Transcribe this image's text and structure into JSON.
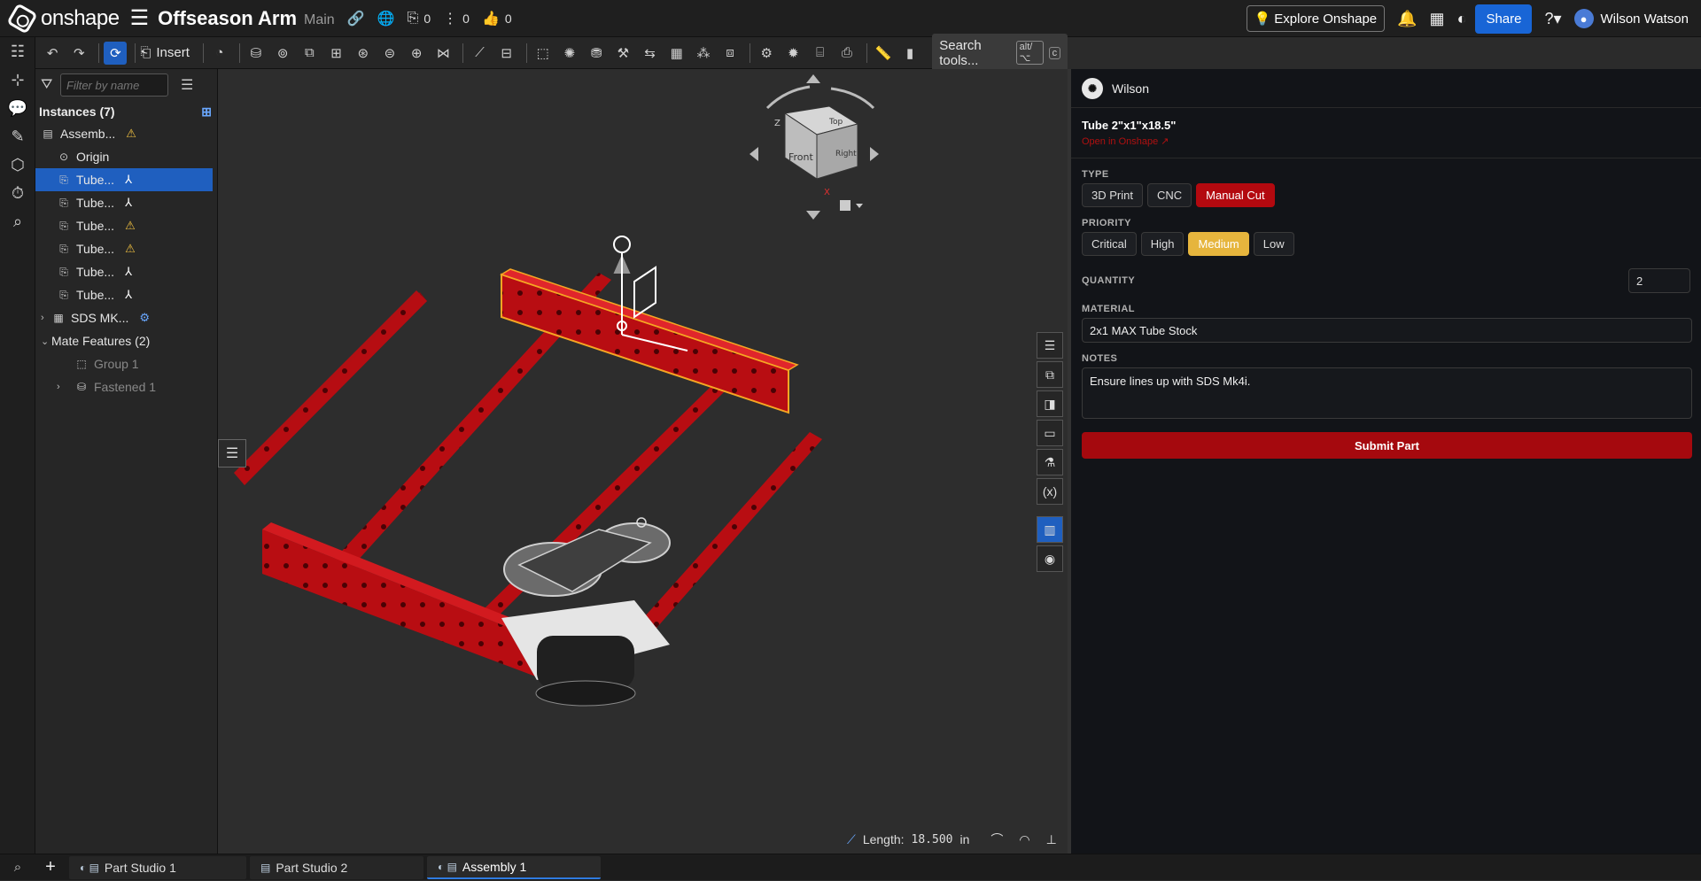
{
  "app": {
    "brand": "onshape",
    "doc_title": "Offseason Arm",
    "branch": "Main",
    "counts": {
      "versions": "0",
      "branches": "0",
      "likes": "0"
    },
    "explore_label": "Explore Onshape",
    "share_label": "Share",
    "user_name": "Wilson Watson"
  },
  "toolbar": {
    "insert_label": "Insert",
    "search_label": "Search tools...",
    "search_kbd1": "alt/⌥",
    "search_kbd2": "c"
  },
  "panel": {
    "filter_placeholder": "Filter by name",
    "instances_header": "Instances (7)",
    "items": [
      {
        "label": "Assemb...",
        "badge": "⚠"
      },
      {
        "label": "Origin"
      },
      {
        "label": "Tube...",
        "badge": "⅄"
      },
      {
        "label": "Tube...",
        "badge": "⅄"
      },
      {
        "label": "Tube...",
        "badge": "⚠"
      },
      {
        "label": "Tube...",
        "badge": "⚠"
      },
      {
        "label": "Tube...",
        "badge": "⅄"
      },
      {
        "label": "Tube...",
        "badge": "⅄"
      },
      {
        "label": "SDS MK...",
        "badge": "⚙"
      }
    ],
    "mates_header": "Mate Features (2)",
    "mates": [
      {
        "label": "Group 1"
      },
      {
        "label": "Fastened 1"
      }
    ]
  },
  "viewport": {
    "cube_labels": {
      "top": "Top",
      "front": "Front",
      "right": "Right",
      "z": "Z",
      "x": "X"
    },
    "length_label": "Length:",
    "length_value": "18.500",
    "length_unit": "in"
  },
  "right_panel": {
    "user": "Wilson",
    "part_title": "Tube 2\"x1\"x18.5\"",
    "part_link": "Open in Onshape ↗",
    "type_label": "TYPE",
    "type_options": [
      "3D Print",
      "CNC",
      "Manual Cut"
    ],
    "priority_label": "PRIORITY",
    "priority_options": [
      "Critical",
      "High",
      "Medium",
      "Low"
    ],
    "quantity_label": "QUANTITY",
    "quantity_value": "2",
    "material_label": "MATERIAL",
    "material_value": "2x1 MAX Tube Stock",
    "notes_label": "NOTES",
    "notes_value": "Ensure lines up with SDS Mk4i.",
    "submit_label": "Submit Part",
    "colors": {
      "accent_red": "#b3090f",
      "accent_gold": "#e6b53d"
    }
  },
  "tabs": [
    {
      "label": "Part Studio 1"
    },
    {
      "label": "Part Studio 2"
    },
    {
      "label": "Assembly 1",
      "active": true
    }
  ]
}
